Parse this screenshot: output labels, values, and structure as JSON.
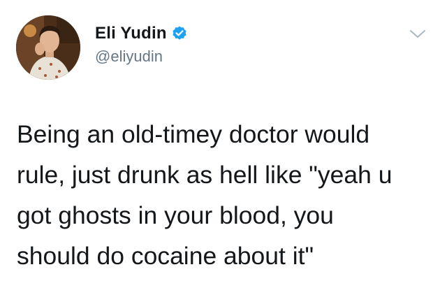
{
  "tweet": {
    "author": {
      "display_name": "Eli Yudin",
      "handle": "@eliyudin",
      "verified_icon": "verified-badge-icon",
      "avatar_icon": "avatar-photo"
    },
    "menu_icon": "chevron-down-icon",
    "text_lines": [
      "Being an old-timey doctor would",
      "rule, just drunk as hell like \"yeah u",
      "got ghosts in your blood, you",
      "should do cocaine about it\""
    ]
  },
  "colors": {
    "verified_blue": "#1da1f2",
    "text": "#14171a",
    "secondary_text": "#657786",
    "chevron": "#aab8c2"
  }
}
